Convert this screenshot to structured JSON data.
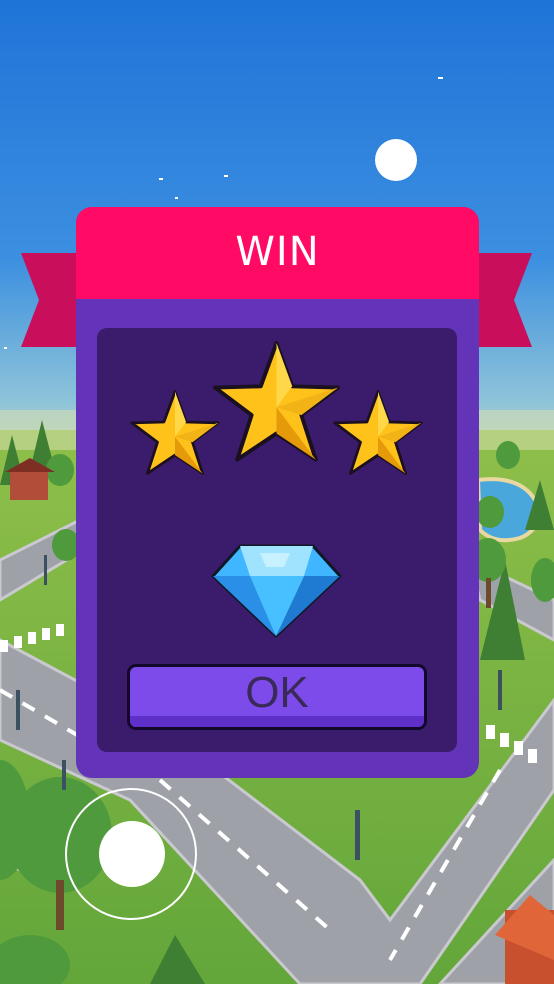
{
  "dialog": {
    "title": "WIN",
    "stars_earned": 3,
    "stars_total": 3,
    "reward_icon": "diamond-icon",
    "ok_label": "OK"
  },
  "colors": {
    "header": "#ff0a64",
    "ribbon": "#c90f5c",
    "panel": "#6334b8",
    "inner_panel": "#3a1b6c",
    "button": "#7d4bea",
    "star": "#ffc21a",
    "gem": "#3fb6ff"
  },
  "controls": {
    "joystick_icon": "joystick-icon"
  }
}
